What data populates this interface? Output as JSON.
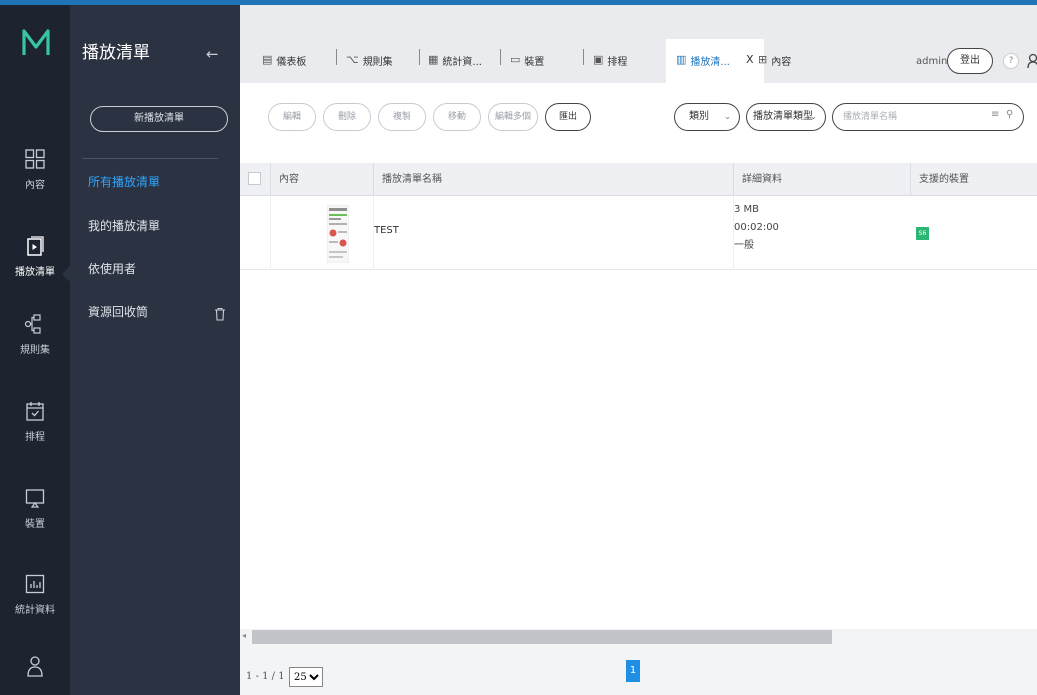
{
  "rail": {
    "items": [
      {
        "label": "內容",
        "icon": "grid-icon"
      },
      {
        "label": "播放清單",
        "icon": "playlist-icon"
      },
      {
        "label": "規則集",
        "icon": "ruleset-icon"
      },
      {
        "label": "排程",
        "icon": "calendar-icon"
      },
      {
        "label": "裝置",
        "icon": "device-icon"
      },
      {
        "label": "統計資料",
        "icon": "chart-icon"
      },
      {
        "label": "",
        "icon": "user-icon"
      }
    ]
  },
  "panel": {
    "title": "播放清單",
    "new_button": "新播放清單",
    "links": [
      "所有播放清單",
      "我的播放清單",
      "依使用者",
      "資源回收筒"
    ]
  },
  "tabs": [
    {
      "label": "儀表板",
      "icon": "dashboard-icon"
    },
    {
      "label": "規則集",
      "icon": "ruleset-icon"
    },
    {
      "label": "統計資...",
      "icon": "stats-icon"
    },
    {
      "label": "裝置",
      "icon": "device-icon"
    },
    {
      "label": "排程",
      "icon": "calendar-icon"
    },
    {
      "label": "播放清...",
      "icon": "playlist-icon",
      "close": "X"
    },
    {
      "label": "內容",
      "icon": "grid-icon"
    }
  ],
  "header": {
    "user": "admin",
    "logout": "登出",
    "help": "?"
  },
  "toolbar": {
    "edit": "編輯",
    "delete": "刪除",
    "copy": "複製",
    "move": "移動",
    "edit_multi": "編輯多個",
    "export": "匯出",
    "category": "類別",
    "playlist_type": "播放清單類型",
    "search_placeholder": "播放清單名稱"
  },
  "table": {
    "columns": [
      "內容",
      "播放清單名稱",
      "詳細資料",
      "支援的裝置"
    ],
    "rows": [
      {
        "name": "TEST",
        "size": "3 MB",
        "duration": "00:02:00",
        "type": "一般",
        "device": "S6"
      }
    ]
  },
  "pager": {
    "range": "1 - 1 / 1",
    "page_size": "25",
    "current_page": "1"
  },
  "colors": {
    "accent": "#2fa4ff",
    "rail_bg": "#1d2430",
    "panel_bg": "#2b3342",
    "badge_green": "#2bb673"
  }
}
